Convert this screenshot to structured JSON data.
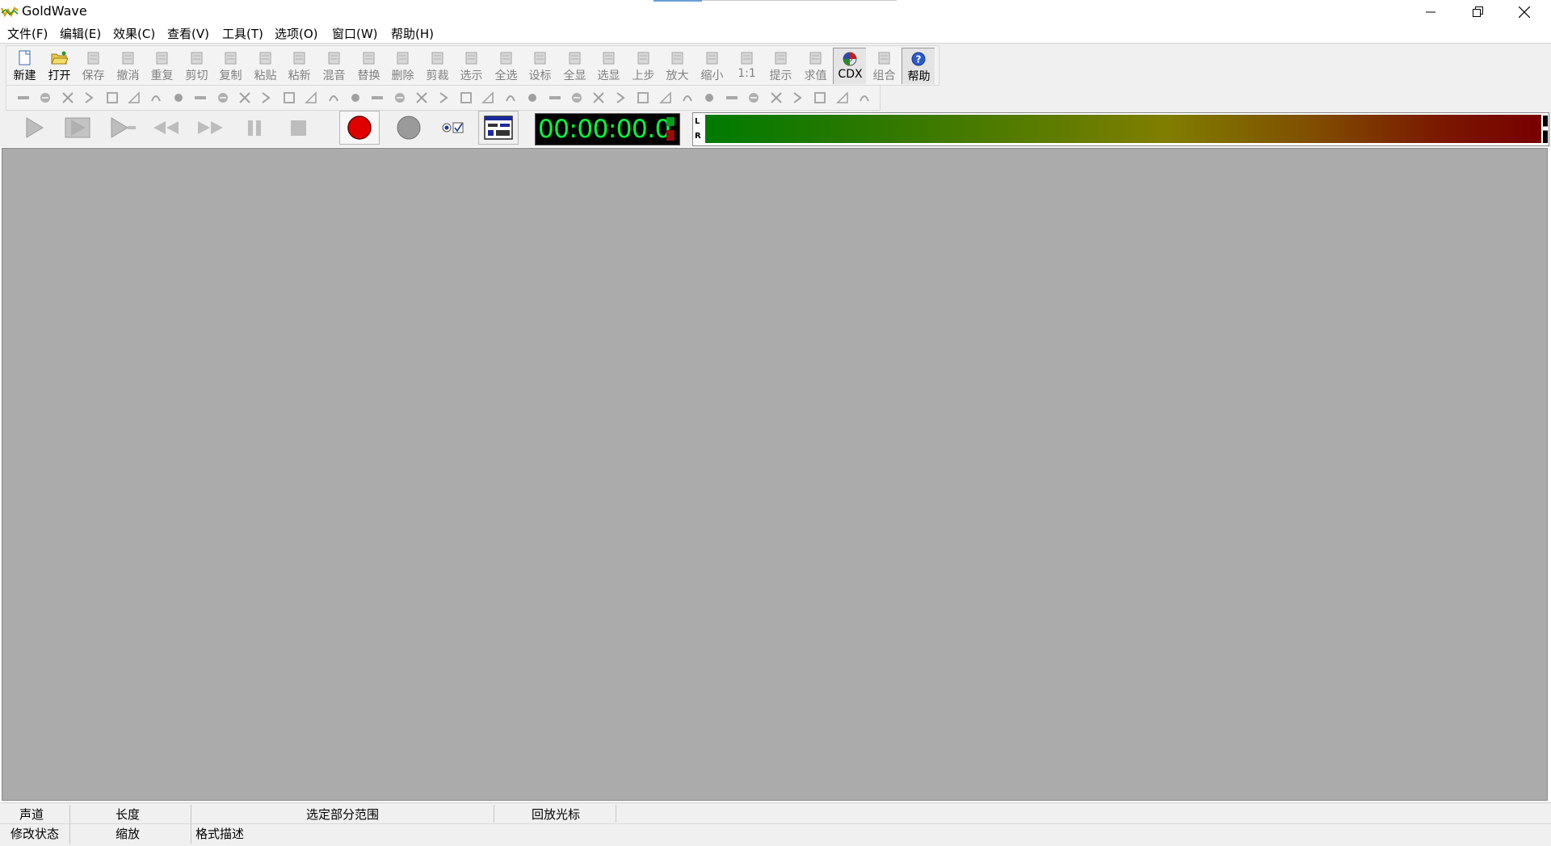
{
  "window": {
    "title": "GoldWave",
    "minimize_icon": "minimize-icon",
    "restore_icon": "restore-icon",
    "close_icon": "close-icon"
  },
  "menu": [
    "文件(F)",
    "编辑(E)",
    "效果(C)",
    "查看(V)",
    "工具(T)",
    "选项(O)",
    "窗口(W)",
    "帮助(H)"
  ],
  "toolbar_main": [
    {
      "label": "新建",
      "icon": "new-file-icon",
      "enabled": true
    },
    {
      "label": "打开",
      "icon": "open-folder-icon",
      "enabled": true
    },
    {
      "label": "保存",
      "icon": "save-disk-icon",
      "enabled": false
    },
    {
      "label": "撤消",
      "icon": "undo-icon",
      "enabled": false
    },
    {
      "label": "重复",
      "icon": "redo-icon",
      "enabled": false
    },
    {
      "label": "剪切",
      "icon": "scissors-icon",
      "enabled": false
    },
    {
      "label": "复制",
      "icon": "copy-icon",
      "enabled": false
    },
    {
      "label": "粘贴",
      "icon": "paste-icon",
      "enabled": false
    },
    {
      "label": "粘新",
      "icon": "paste-new-icon",
      "enabled": false
    },
    {
      "label": "混音",
      "icon": "mix-icon",
      "enabled": false
    },
    {
      "label": "替换",
      "icon": "replace-icon",
      "enabled": false
    },
    {
      "label": "删除",
      "icon": "delete-icon",
      "enabled": false
    },
    {
      "label": "剪裁",
      "icon": "trim-icon",
      "enabled": false
    },
    {
      "label": "选示",
      "icon": "select-view-icon",
      "enabled": false
    },
    {
      "label": "全选",
      "icon": "select-all-icon",
      "enabled": false
    },
    {
      "label": "设标",
      "icon": "set-marker-icon",
      "enabled": false
    },
    {
      "label": "全显",
      "icon": "show-all-icon",
      "enabled": false
    },
    {
      "label": "选显",
      "icon": "zoom-selection-icon",
      "enabled": false
    },
    {
      "label": "上步",
      "icon": "previous-zoom-icon",
      "enabled": false
    },
    {
      "label": "放大",
      "icon": "zoom-in-icon",
      "enabled": false
    },
    {
      "label": "缩小",
      "icon": "zoom-out-icon",
      "enabled": false
    },
    {
      "label": "1:1",
      "icon": "zoom-one-to-one-icon",
      "enabled": false
    },
    {
      "label": "提示",
      "icon": "cue-points-icon",
      "enabled": false
    },
    {
      "label": "求值",
      "icon": "expression-evaluator-icon",
      "enabled": false
    },
    {
      "label": "CDX",
      "icon": "cd-extract-icon",
      "enabled": true
    },
    {
      "label": "组合",
      "icon": "batch-combine-icon",
      "enabled": false
    },
    {
      "label": "帮助",
      "icon": "help-icon",
      "enabled": true
    }
  ],
  "effects_toolbar_count": 39,
  "transport": {
    "time_display": "00:00:00.0",
    "play_icon": "play-icon",
    "play_selection_icon": "play-selection-icon",
    "play_from_icon": "play-from-cursor-icon",
    "rewind_icon": "rewind-icon",
    "fast_forward_icon": "fast-forward-icon",
    "pause_icon": "pause-icon",
    "stop_icon": "stop-icon",
    "record_icon": "record-icon",
    "record_stop_icon": "record-stop-icon",
    "options_icon": "control-options-icon",
    "properties_icon": "control-properties-icon"
  },
  "level_meter": {
    "left_label": "L",
    "right_label": "R"
  },
  "status": {
    "channels": "声道",
    "length": "长度",
    "selection_range": "选定部分范围",
    "playback_cursor": "回放光标",
    "modified": "修改状态",
    "zoom": "缩放",
    "format": "格式描述"
  },
  "colors": {
    "workspace": "#ababab",
    "timer_text": "#00ff3c",
    "record_red": "#e00000",
    "meter_start": "#007a00",
    "meter_end": "#780000"
  }
}
